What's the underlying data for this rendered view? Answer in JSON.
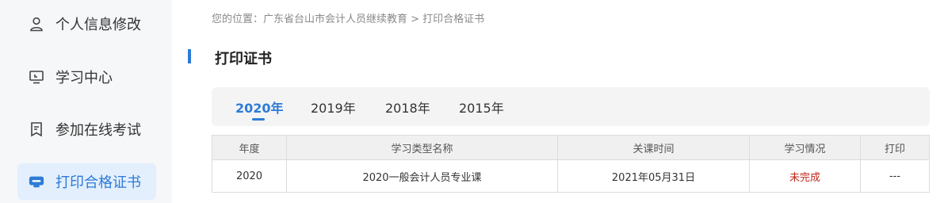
{
  "sidebar": {
    "items": [
      {
        "label": "个人信息修改",
        "icon": "user-icon"
      },
      {
        "label": "学习中心",
        "icon": "monitor-icon"
      },
      {
        "label": "参加在线考试",
        "icon": "exam-icon"
      },
      {
        "label": "打印合格证书",
        "icon": "certificate-icon",
        "active": true
      }
    ]
  },
  "breadcrumb": "您的位置：广东省台山市会计人员继续教育 > 打印合格证书",
  "page_title": "打印证书",
  "tabs": [
    "2020年",
    "2019年",
    "2018年",
    "2015年"
  ],
  "active_tab": "2020年",
  "table": {
    "headers": [
      "年度",
      "学习类型名称",
      "关课时间",
      "学习情况",
      "打印"
    ],
    "rows": [
      {
        "year": "2020",
        "type_name": "2020一般会计人员专业课",
        "close_time": "2021年05月31日",
        "status": "未完成",
        "print": "---"
      }
    ]
  },
  "colors": {
    "accent": "#2d7bd6",
    "status_incomplete": "#c0271c",
    "sidebar_bg": "#f6f7f9",
    "active_bg": "#e3effc"
  }
}
